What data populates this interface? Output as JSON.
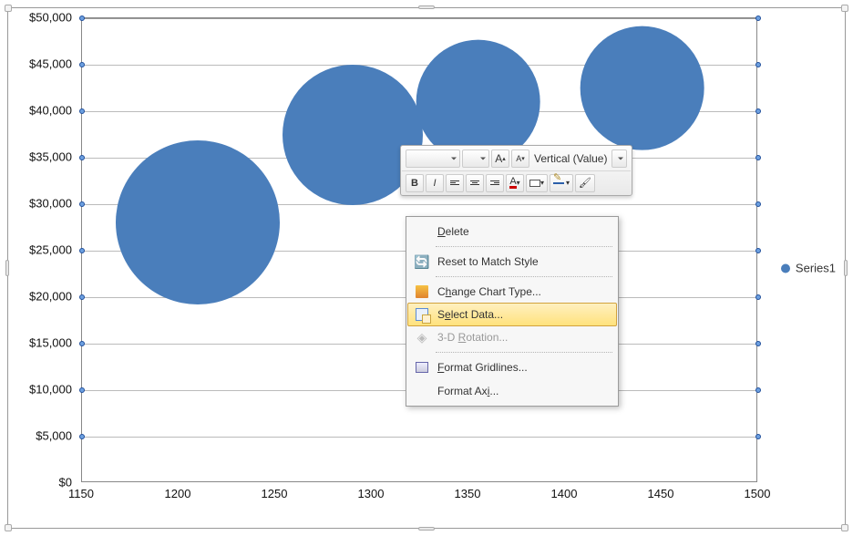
{
  "legend": {
    "series1": "Series1"
  },
  "y_axis": {
    "ticks": [
      "$50,000",
      "$45,000",
      "$40,000",
      "$35,000",
      "$30,000",
      "$25,000",
      "$20,000",
      "$15,000",
      "$10,000",
      "$5,000",
      "$0"
    ]
  },
  "x_axis": {
    "ticks": [
      "1150",
      "1200",
      "1250",
      "1300",
      "1350",
      "1400",
      "1450",
      "1500"
    ]
  },
  "mini_toolbar": {
    "font_size_label_large": "Aᴬ",
    "font_size_label_small": "Aᴬ",
    "scope_label": "Vertical (Value)",
    "bold": "B",
    "italic": "I",
    "font_color": "A"
  },
  "context_menu": {
    "delete": "Delete",
    "reset": "Reset to Match Style",
    "change_type": "Change Chart Type...",
    "select_data": "Select Data...",
    "rotation": "3-D Rotation...",
    "format_gridlines": "Format Gridlines...",
    "format_axis": "Format Axis..."
  },
  "chart_data": {
    "type": "bubble",
    "title": "",
    "xlabel": "",
    "ylabel": "",
    "xlim": [
      1150,
      1500
    ],
    "ylim": [
      0,
      50000
    ],
    "y_ticks": [
      0,
      5000,
      10000,
      15000,
      20000,
      25000,
      30000,
      35000,
      40000,
      45000,
      50000
    ],
    "x_ticks": [
      1150,
      1200,
      1250,
      1300,
      1350,
      1400,
      1450,
      1500
    ],
    "series": [
      {
        "name": "Series1",
        "points": [
          {
            "x": 1210,
            "y": 28000,
            "size": 75
          },
          {
            "x": 1290,
            "y": 37500,
            "size": 60
          },
          {
            "x": 1355,
            "y": 41000,
            "size": 50
          },
          {
            "x": 1440,
            "y": 42500,
            "size": 50
          }
        ]
      }
    ],
    "grid": true,
    "legend_position": "right"
  }
}
